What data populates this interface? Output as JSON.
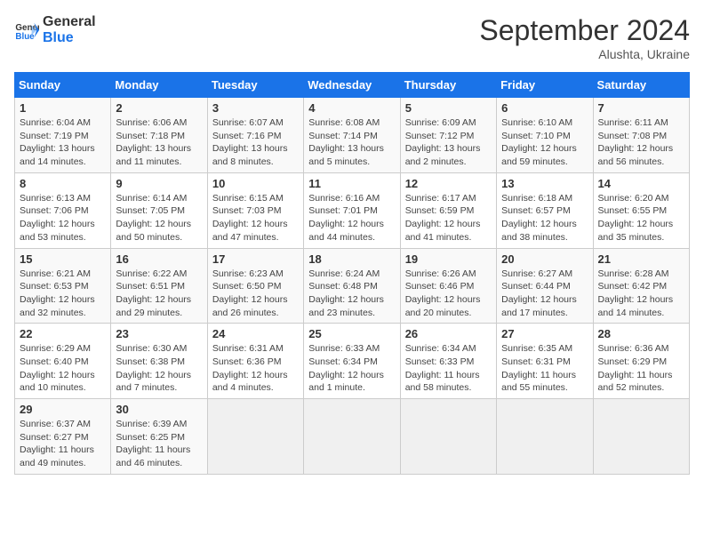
{
  "header": {
    "logo_line1": "General",
    "logo_line2": "Blue",
    "month_title": "September 2024",
    "subtitle": "Alushta, Ukraine"
  },
  "days_of_week": [
    "Sunday",
    "Monday",
    "Tuesday",
    "Wednesday",
    "Thursday",
    "Friday",
    "Saturday"
  ],
  "weeks": [
    [
      {
        "day": "1",
        "sunrise": "6:04 AM",
        "sunset": "7:19 PM",
        "daylight": "13 hours and 14 minutes."
      },
      {
        "day": "2",
        "sunrise": "6:06 AM",
        "sunset": "7:18 PM",
        "daylight": "13 hours and 11 minutes."
      },
      {
        "day": "3",
        "sunrise": "6:07 AM",
        "sunset": "7:16 PM",
        "daylight": "13 hours and 8 minutes."
      },
      {
        "day": "4",
        "sunrise": "6:08 AM",
        "sunset": "7:14 PM",
        "daylight": "13 hours and 5 minutes."
      },
      {
        "day": "5",
        "sunrise": "6:09 AM",
        "sunset": "7:12 PM",
        "daylight": "13 hours and 2 minutes."
      },
      {
        "day": "6",
        "sunrise": "6:10 AM",
        "sunset": "7:10 PM",
        "daylight": "12 hours and 59 minutes."
      },
      {
        "day": "7",
        "sunrise": "6:11 AM",
        "sunset": "7:08 PM",
        "daylight": "12 hours and 56 minutes."
      }
    ],
    [
      {
        "day": "8",
        "sunrise": "6:13 AM",
        "sunset": "7:06 PM",
        "daylight": "12 hours and 53 minutes."
      },
      {
        "day": "9",
        "sunrise": "6:14 AM",
        "sunset": "7:05 PM",
        "daylight": "12 hours and 50 minutes."
      },
      {
        "day": "10",
        "sunrise": "6:15 AM",
        "sunset": "7:03 PM",
        "daylight": "12 hours and 47 minutes."
      },
      {
        "day": "11",
        "sunrise": "6:16 AM",
        "sunset": "7:01 PM",
        "daylight": "12 hours and 44 minutes."
      },
      {
        "day": "12",
        "sunrise": "6:17 AM",
        "sunset": "6:59 PM",
        "daylight": "12 hours and 41 minutes."
      },
      {
        "day": "13",
        "sunrise": "6:18 AM",
        "sunset": "6:57 PM",
        "daylight": "12 hours and 38 minutes."
      },
      {
        "day": "14",
        "sunrise": "6:20 AM",
        "sunset": "6:55 PM",
        "daylight": "12 hours and 35 minutes."
      }
    ],
    [
      {
        "day": "15",
        "sunrise": "6:21 AM",
        "sunset": "6:53 PM",
        "daylight": "12 hours and 32 minutes."
      },
      {
        "day": "16",
        "sunrise": "6:22 AM",
        "sunset": "6:51 PM",
        "daylight": "12 hours and 29 minutes."
      },
      {
        "day": "17",
        "sunrise": "6:23 AM",
        "sunset": "6:50 PM",
        "daylight": "12 hours and 26 minutes."
      },
      {
        "day": "18",
        "sunrise": "6:24 AM",
        "sunset": "6:48 PM",
        "daylight": "12 hours and 23 minutes."
      },
      {
        "day": "19",
        "sunrise": "6:26 AM",
        "sunset": "6:46 PM",
        "daylight": "12 hours and 20 minutes."
      },
      {
        "day": "20",
        "sunrise": "6:27 AM",
        "sunset": "6:44 PM",
        "daylight": "12 hours and 17 minutes."
      },
      {
        "day": "21",
        "sunrise": "6:28 AM",
        "sunset": "6:42 PM",
        "daylight": "12 hours and 14 minutes."
      }
    ],
    [
      {
        "day": "22",
        "sunrise": "6:29 AM",
        "sunset": "6:40 PM",
        "daylight": "12 hours and 10 minutes."
      },
      {
        "day": "23",
        "sunrise": "6:30 AM",
        "sunset": "6:38 PM",
        "daylight": "12 hours and 7 minutes."
      },
      {
        "day": "24",
        "sunrise": "6:31 AM",
        "sunset": "6:36 PM",
        "daylight": "12 hours and 4 minutes."
      },
      {
        "day": "25",
        "sunrise": "6:33 AM",
        "sunset": "6:34 PM",
        "daylight": "12 hours and 1 minute."
      },
      {
        "day": "26",
        "sunrise": "6:34 AM",
        "sunset": "6:33 PM",
        "daylight": "11 hours and 58 minutes."
      },
      {
        "day": "27",
        "sunrise": "6:35 AM",
        "sunset": "6:31 PM",
        "daylight": "11 hours and 55 minutes."
      },
      {
        "day": "28",
        "sunrise": "6:36 AM",
        "sunset": "6:29 PM",
        "daylight": "11 hours and 52 minutes."
      }
    ],
    [
      {
        "day": "29",
        "sunrise": "6:37 AM",
        "sunset": "6:27 PM",
        "daylight": "11 hours and 49 minutes."
      },
      {
        "day": "30",
        "sunrise": "6:39 AM",
        "sunset": "6:25 PM",
        "daylight": "11 hours and 46 minutes."
      },
      null,
      null,
      null,
      null,
      null
    ]
  ],
  "labels": {
    "sunrise": "Sunrise:",
    "sunset": "Sunset:",
    "daylight": "Daylight:"
  }
}
